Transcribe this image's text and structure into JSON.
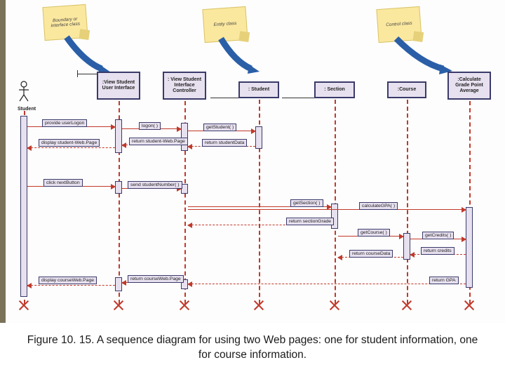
{
  "caption": "Figure 10. 15. A sequence diagram for using two Web pages: one for student information, one for course information.",
  "stickies": [
    {
      "text": "Boundary or interface class"
    },
    {
      "text": "Entity class"
    },
    {
      "text": "Control class"
    }
  ],
  "actor": {
    "label": "Student"
  },
  "lifelines": [
    {
      "label": ":View Student User Interface"
    },
    {
      "label": ": View Student Interface Controller"
    },
    {
      "label": ": Student"
    },
    {
      "label": ": Section"
    },
    {
      "label": ":Course"
    },
    {
      "label": ":Calculate Grade Point Average"
    }
  ],
  "messages": {
    "m1": "provide userLogon",
    "m2": "logon( )",
    "m3": "getStudent( )",
    "m4": "return studentData",
    "m5": "return student-Web.Page",
    "m6": "display student-Web.Page",
    "m7": "click nextButton",
    "m8": "send studentNumber( )",
    "m9": "getSection( )",
    "m10": "calculateGPA( )",
    "m11": "return sectionGrade",
    "m12": "getCourse( )",
    "m13": "getCredits( )",
    "m14": "return credits",
    "m15": "return courseData",
    "m16": "return GPA",
    "m17": "return courseWeb.Page",
    "m18": "display courseWeb.Page"
  }
}
